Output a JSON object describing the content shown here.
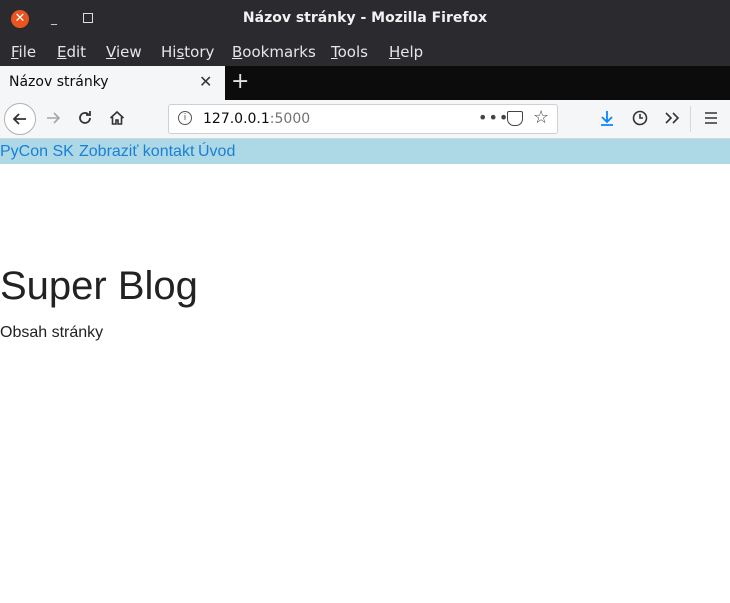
{
  "window": {
    "title": "Názov stránky - Mozilla Firefox",
    "close_glyph": "✕",
    "minimize_glyph": "_"
  },
  "menubar": {
    "items": [
      {
        "first": "F",
        "rest": "ile"
      },
      {
        "first": "E",
        "rest": "dit"
      },
      {
        "first": "V",
        "rest": "iew"
      },
      {
        "first": "Hi",
        "rest": "story",
        "underline_index": 2
      },
      {
        "first": "B",
        "rest": "ookmarks"
      },
      {
        "first": "T",
        "rest": "ools"
      },
      {
        "first": "H",
        "rest": "elp"
      }
    ]
  },
  "tabs": {
    "active_label": "Názov stránky",
    "close_glyph": "✕",
    "new_tab_glyph": "+"
  },
  "toolbar": {
    "url_host": "127.0.0.1",
    "url_port": ":5000",
    "icons": [
      "back-arrow-icon",
      "forward-arrow-icon",
      "reload-icon",
      "home-icon",
      "info-icon",
      "page-actions-icon",
      "pocket-icon",
      "bookmark-star-icon",
      "download-icon",
      "history-icon",
      "overflow-icon",
      "hamburger-menu-icon"
    ]
  },
  "site_nav": {
    "links": [
      "PyCon SK",
      "Zobraziť kontakt",
      "Úvod"
    ]
  },
  "page": {
    "heading": "Super Blog",
    "body": "Obsah stránky"
  },
  "colors": {
    "titlebar": "#2b2a2e",
    "site_nav_bg": "#add8e6",
    "link": "#1a7fd6",
    "close_button": "#e95420",
    "download_accent": "#0a84ff"
  }
}
